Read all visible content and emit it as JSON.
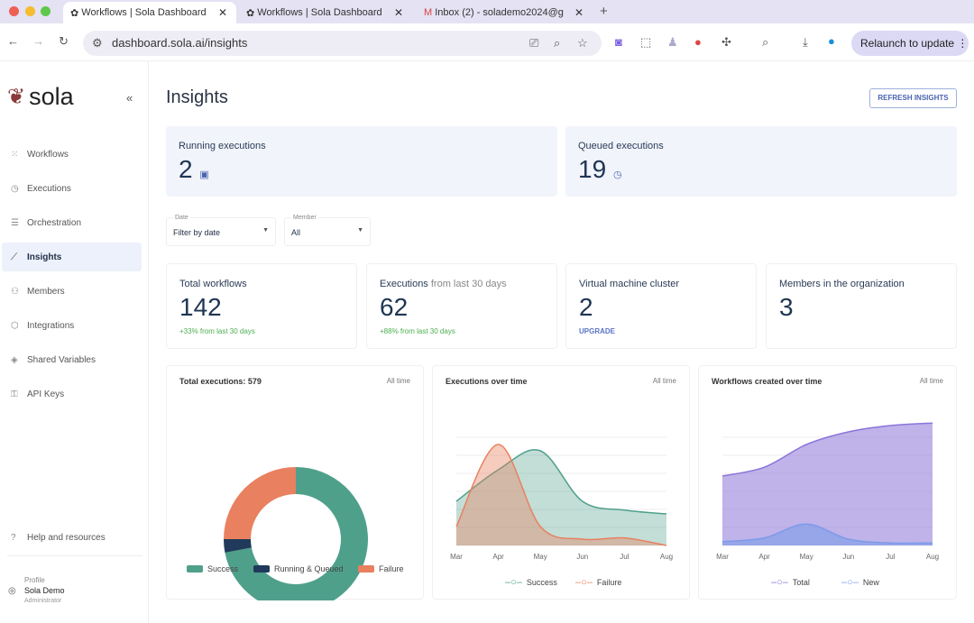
{
  "browser": {
    "tabs": [
      {
        "title": "Workflows | Sola Dashboard",
        "active": true
      },
      {
        "title": "Workflows | Sola Dashboard",
        "active": false
      },
      {
        "title": "Inbox (2) - solademo2024@g",
        "active": false
      }
    ],
    "url": "dashboard.sola.ai/insights",
    "relaunch": "Relaunch to update"
  },
  "sidebar": {
    "logo": "sola",
    "items": [
      {
        "label": "Workflows",
        "icon": "grid-icon"
      },
      {
        "label": "Executions",
        "icon": "clock-icon"
      },
      {
        "label": "Orchestration",
        "icon": "sliders-icon"
      },
      {
        "label": "Insights",
        "icon": "chart-icon",
        "active": true
      },
      {
        "label": "Members",
        "icon": "users-icon"
      },
      {
        "label": "Integrations",
        "icon": "puzzle-icon"
      },
      {
        "label": "Shared Variables",
        "icon": "layers-icon"
      },
      {
        "label": "API Keys",
        "icon": "key-icon"
      }
    ],
    "help": "Help and resources",
    "profile": {
      "label": "Profile",
      "name": "Sola Demo",
      "role": "Administrator"
    }
  },
  "page": {
    "title": "Insights",
    "refresh": "REFRESH INSIGHTS"
  },
  "running": {
    "label": "Running executions",
    "value": "2"
  },
  "queued": {
    "label": "Queued executions",
    "value": "19"
  },
  "filters": {
    "date": {
      "label": "Date",
      "value": "Filter by date"
    },
    "member": {
      "label": "Member",
      "value": "All"
    }
  },
  "stats": [
    {
      "label": "Total workflows",
      "label2": "",
      "value": "142",
      "sub": "+33% from last 30 days"
    },
    {
      "label": "Executions",
      "label2": " from last 30 days",
      "value": "62",
      "sub": "+88% from last 30 days"
    },
    {
      "label": "Virtual machine cluster",
      "label2": "",
      "value": "2",
      "link": "UPGRADE"
    },
    {
      "label": "Members in the organization",
      "label2": "",
      "value": "3"
    }
  ],
  "colors": {
    "success": "#4fa08b",
    "running": "#1f3a5a",
    "failure": "#e9805f",
    "total": "#8b74d8",
    "new": "#7d9be8"
  },
  "chart_data": [
    {
      "type": "pie",
      "title": "Total executions: 579",
      "range": "All time",
      "categories": [
        "Success",
        "Running & Queued",
        "Failure"
      ],
      "values": [
        72,
        3,
        25
      ]
    },
    {
      "type": "area",
      "title": "Executions over time",
      "range": "All time",
      "categories": [
        "Mar",
        "Apr",
        "May",
        "Jun",
        "Jul",
        "Aug"
      ],
      "series": [
        {
          "name": "Success",
          "values": [
            35,
            60,
            75,
            35,
            28,
            25
          ]
        },
        {
          "name": "Failure",
          "values": [
            15,
            80,
            15,
            5,
            6,
            0
          ]
        }
      ]
    },
    {
      "type": "area",
      "title": "Workflows created over time",
      "range": "All time",
      "categories": [
        "Mar",
        "Apr",
        "May",
        "Jun",
        "Jul",
        "Aug"
      ],
      "series": [
        {
          "name": "Total",
          "values": [
            55,
            62,
            80,
            90,
            95,
            97
          ]
        },
        {
          "name": "New",
          "values": [
            3,
            6,
            17,
            5,
            2,
            2
          ]
        }
      ]
    }
  ]
}
